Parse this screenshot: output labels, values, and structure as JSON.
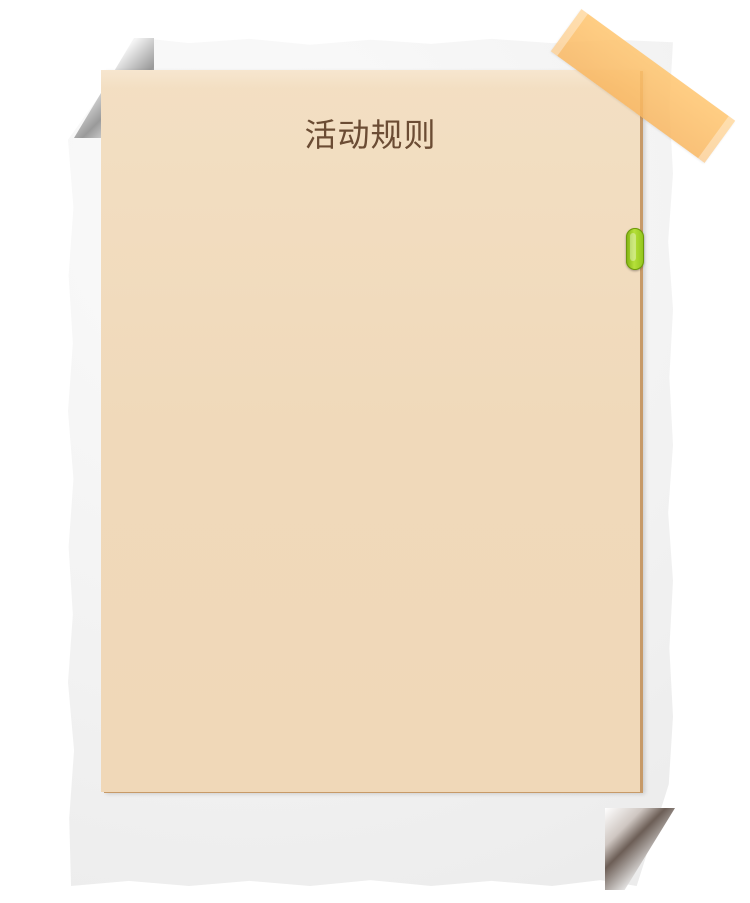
{
  "dialog": {
    "title": "活动规则"
  },
  "colors": {
    "card": "#f0d9ba",
    "title_text": "#6b4c34",
    "tape": "#f8b660",
    "scroll_thumb": "#9ccf25"
  },
  "icons": {
    "tape": "tape-icon",
    "scroll_thumb": "scrollbar-thumb"
  }
}
